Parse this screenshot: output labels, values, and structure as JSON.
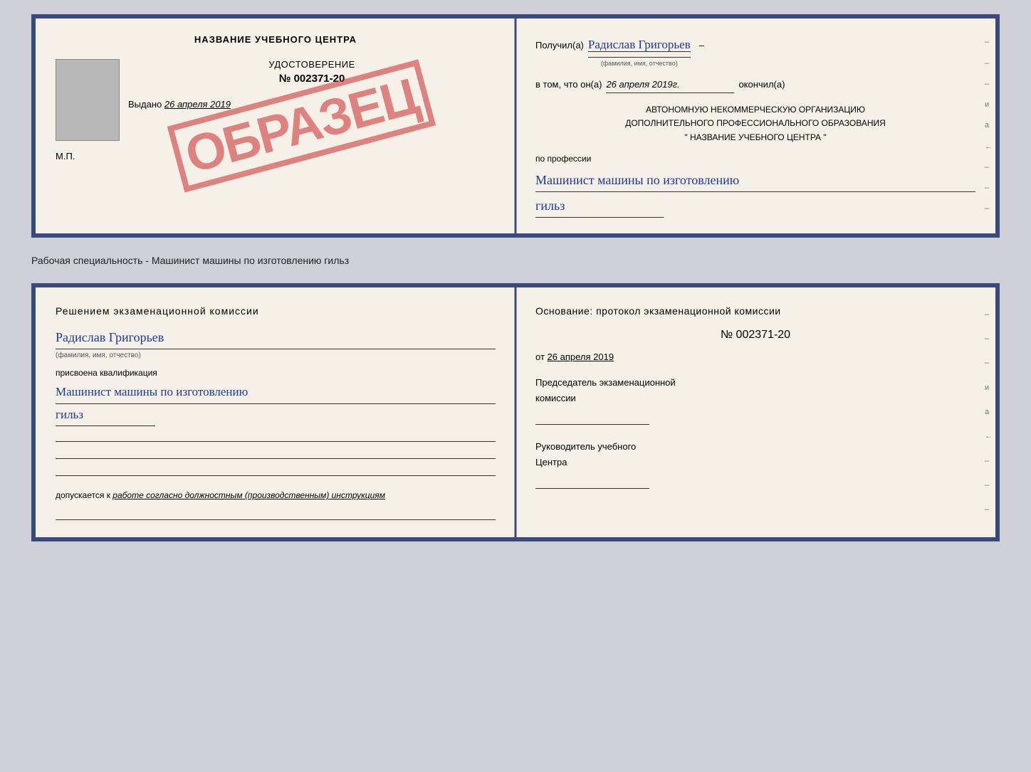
{
  "top_doc": {
    "left": {
      "school_name": "НАЗВАНИЕ УЧЕБНОГО ЦЕНТРА",
      "cert_title": "УДОСТОВЕРЕНИЕ",
      "cert_number": "№ 002371-20",
      "issued_label": "Выдано",
      "issued_date": "26 апреля 2019",
      "mp_label": "М.П.",
      "stamp_text": "ОБРАЗЕЦ"
    },
    "right": {
      "received_label": "Получил(а)",
      "received_name": "Радислав Григорьев",
      "fio_hint": "(фамилия, имя, отчество)",
      "dash": "–",
      "in_that_label": "в том, что он(а)",
      "completed_date": "26 апреля 2019г.",
      "completed_label": "окончил(а)",
      "org_line1": "АВТОНОМНУЮ НЕКОММЕРЧЕСКУЮ ОРГАНИЗАЦИЮ",
      "org_line2": "ДОПОЛНИТЕЛЬНОГО ПРОФЕССИОНАЛЬНОГО ОБРАЗОВАНИЯ",
      "org_quote1": "\"",
      "org_name": "НАЗВАНИЕ УЧЕБНОГО ЦЕНТРА",
      "org_quote2": "\"",
      "profession_label": "по профессии",
      "profession_handwritten": "Машинист машины по изготовлению",
      "profession_line2": "гильз"
    }
  },
  "specialty_label": "Рабочая специальность - Машинист машины по изготовлению гильз",
  "bottom_doc": {
    "left": {
      "decision_text": "Решением  экзаменационной  комиссии",
      "name_handwritten": "Радислав Григорьев",
      "fio_hint": "(фамилия, имя, отчество)",
      "assigned_label": "присвоена квалификация",
      "qualification_line1": "Машинист машины по изготовлению",
      "qualification_line2": "гильз",
      "allowed_prefix": "допускается к",
      "allowed_text": "работе согласно должностным (производственным) инструкциям"
    },
    "right": {
      "basis_label": "Основание: протокол экзаменационной  комиссии",
      "protocol_number": "№  002371-20",
      "date_prefix": "от",
      "protocol_date": "26 апреля 2019",
      "chairman_line1": "Председатель экзаменационной",
      "chairman_line2": "комиссии",
      "director_line1": "Руководитель учебного",
      "director_line2": "Центра"
    }
  },
  "margin_symbols": {
    "dashes": [
      "–",
      "–",
      "–",
      "и",
      "а",
      "←",
      "–",
      "–",
      "–"
    ]
  }
}
